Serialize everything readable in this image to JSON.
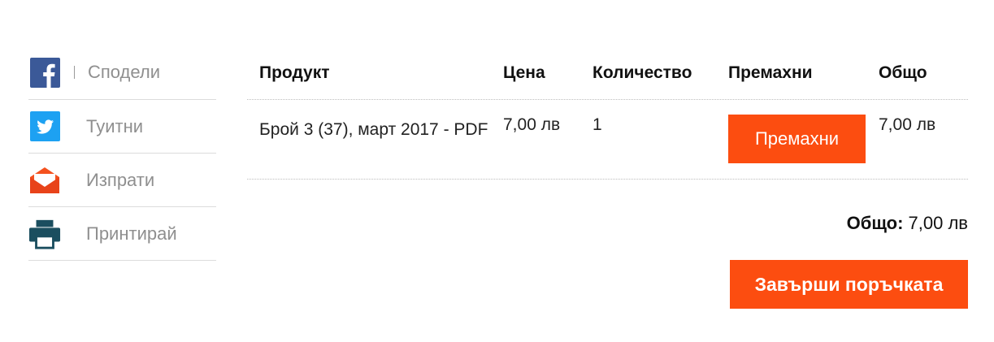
{
  "share": {
    "items": [
      {
        "label": "Сподели",
        "icon": "facebook-icon",
        "color": "#3b5998"
      },
      {
        "label": "Туитни",
        "icon": "twitter-icon",
        "color": "#1da1f2"
      },
      {
        "label": "Изпрати",
        "icon": "email-icon",
        "color": "#f4511e"
      },
      {
        "label": "Принтирай",
        "icon": "print-icon",
        "color": "#1b4e5f"
      }
    ]
  },
  "cart": {
    "headers": {
      "product": "Продукт",
      "price": "Цена",
      "quantity": "Количество",
      "remove": "Премахни",
      "total": "Общо"
    },
    "items": [
      {
        "product": "Брой 3 (37), март 2017 - PDF",
        "price": "7,00 лв",
        "quantity": "1",
        "remove_label": "Премахни",
        "total": "7,00 лв"
      }
    ],
    "grand_total_label": "Общо:",
    "grand_total_value": "7,00 лв",
    "checkout_label": "Завърши поръчката"
  },
  "colors": {
    "accent": "#fc4d10",
    "muted_text": "#8f8f8f"
  }
}
